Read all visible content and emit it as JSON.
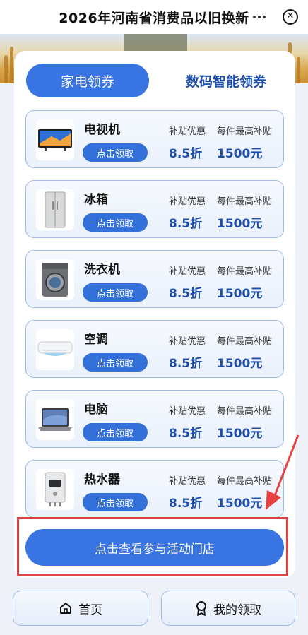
{
  "header": {
    "title": "2026年河南省消费品以旧换新"
  },
  "tabs": [
    {
      "label": "家电领券",
      "active": true
    },
    {
      "label": "数码智能领券",
      "active": false
    }
  ],
  "products": [
    {
      "name": "电视机",
      "icon": "tv-icon",
      "claim_label": "点击领取",
      "subsidy_label": "补贴优惠",
      "subsidy_value": "8.5折",
      "max_label": "每件最高补贴",
      "max_value": "1500元"
    },
    {
      "name": "冰箱",
      "icon": "fridge-icon",
      "claim_label": "点击领取",
      "subsidy_label": "补贴优惠",
      "subsidy_value": "8.5折",
      "max_label": "每件最高补贴",
      "max_value": "1500元"
    },
    {
      "name": "洗衣机",
      "icon": "washing-machine-icon",
      "claim_label": "点击领取",
      "subsidy_label": "补贴优惠",
      "subsidy_value": "8.5折",
      "max_label": "每件最高补贴",
      "max_value": "1500元"
    },
    {
      "name": "空调",
      "icon": "air-conditioner-icon",
      "claim_label": "点击领取",
      "subsidy_label": "补贴优惠",
      "subsidy_value": "8.5折",
      "max_label": "每件最高补贴",
      "max_value": "1500元"
    },
    {
      "name": "电脑",
      "icon": "laptop-icon",
      "claim_label": "点击领取",
      "subsidy_label": "补贴优惠",
      "subsidy_value": "8.5折",
      "max_label": "每件最高补贴",
      "max_value": "1500元"
    },
    {
      "name": "热水器",
      "icon": "water-heater-icon",
      "claim_label": "点击领取",
      "subsidy_label": "补贴优惠",
      "subsidy_value": "8.5折",
      "max_label": "每件最高补贴",
      "max_value": "1500元"
    }
  ],
  "cta": {
    "label": "点击查看参与活动门店"
  },
  "bottom_nav": [
    {
      "label": "首页",
      "icon": "home-icon"
    },
    {
      "label": "我的领取",
      "icon": "award-icon"
    }
  ],
  "colors": {
    "primary": "#3874e2",
    "accent_text": "#1d4ea9",
    "highlight": "#e64242"
  }
}
